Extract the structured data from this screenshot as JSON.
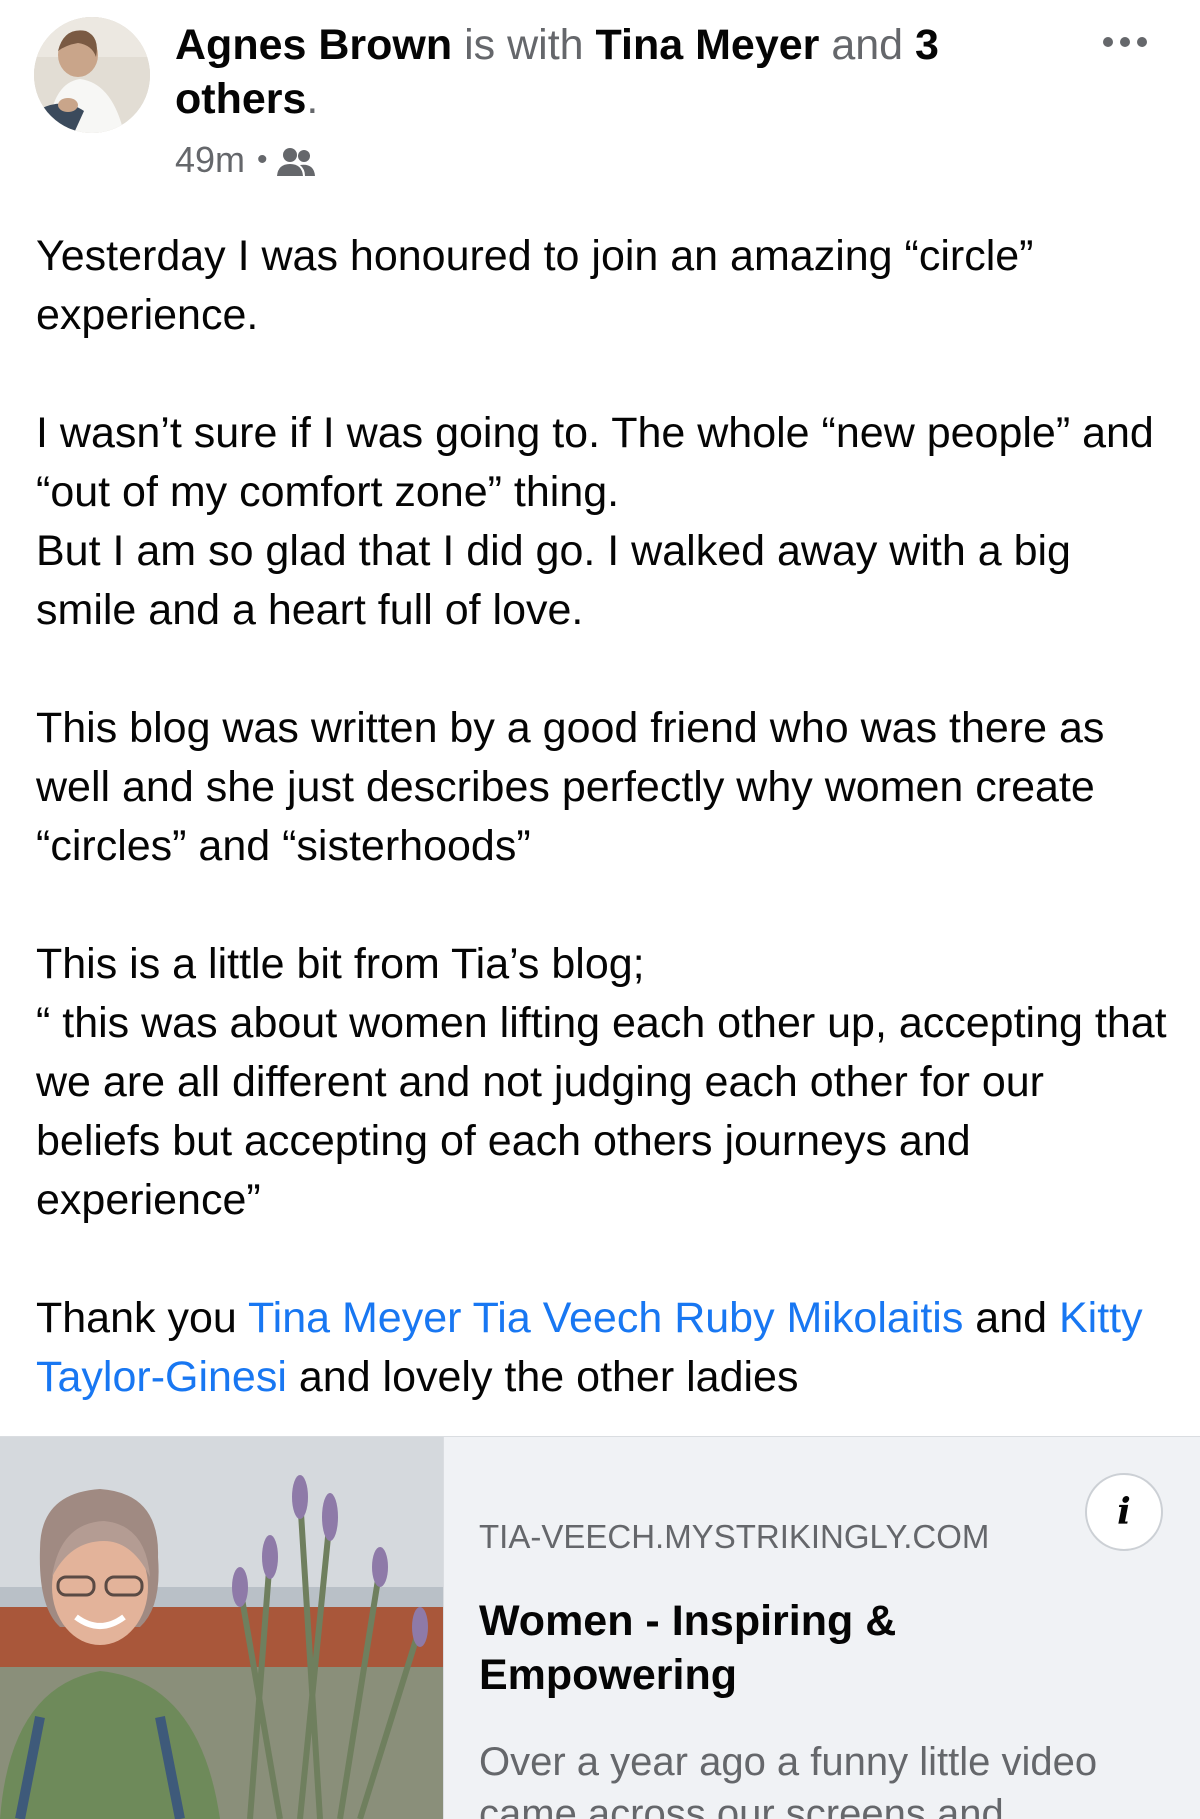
{
  "header": {
    "author": "Agnes Brown",
    "with_text": "is with",
    "tagged": "Tina Meyer",
    "and_text": "and",
    "others": "3 others",
    "period": ".",
    "time": "49m",
    "separator": "•",
    "audience_icon": "friends-icon",
    "more_icon": "more-horizontal-icon"
  },
  "post": {
    "paragraph_1": "Yesterday I was honoured to join an amazing “circle” experience.",
    "paragraph_2": "I wasn’t sure if I was going to. The whole “new people” and “out of my comfort zone” thing.\nBut I am so glad that I did go. I walked away with a big smile and a heart full of love.",
    "paragraph_3": "This blog was written by a good friend who was there as well and she just describes perfectly why women create “circles” and “sisterhoods”",
    "paragraph_4": "This is a little bit from Tia’s blog;\n“ this was about women lifting each other up, accepting that we are all different and not judging each other for our beliefs but accepting of each others journeys and experience”",
    "thanks_prefix": "Thank you",
    "mention_1": "Tina Meyer",
    "mention_2": "Tia Veech",
    "mention_3": "Ruby Mikolaitis",
    "and_text": "and",
    "mention_4": "Kitty Taylor-Ginesi",
    "thanks_suffix": "and lovely the other ladies"
  },
  "link_preview": {
    "domain": "TIA-VEECH.MYSTRIKINGLY.COM",
    "title": "Women - Inspiring & Empowering",
    "description": "Over a year ago a funny little video came across our screens and",
    "info_icon": "info-icon"
  },
  "colors": {
    "link": "#1877f2",
    "secondary_text": "#65676b",
    "preview_bg": "#f0f2f5"
  }
}
